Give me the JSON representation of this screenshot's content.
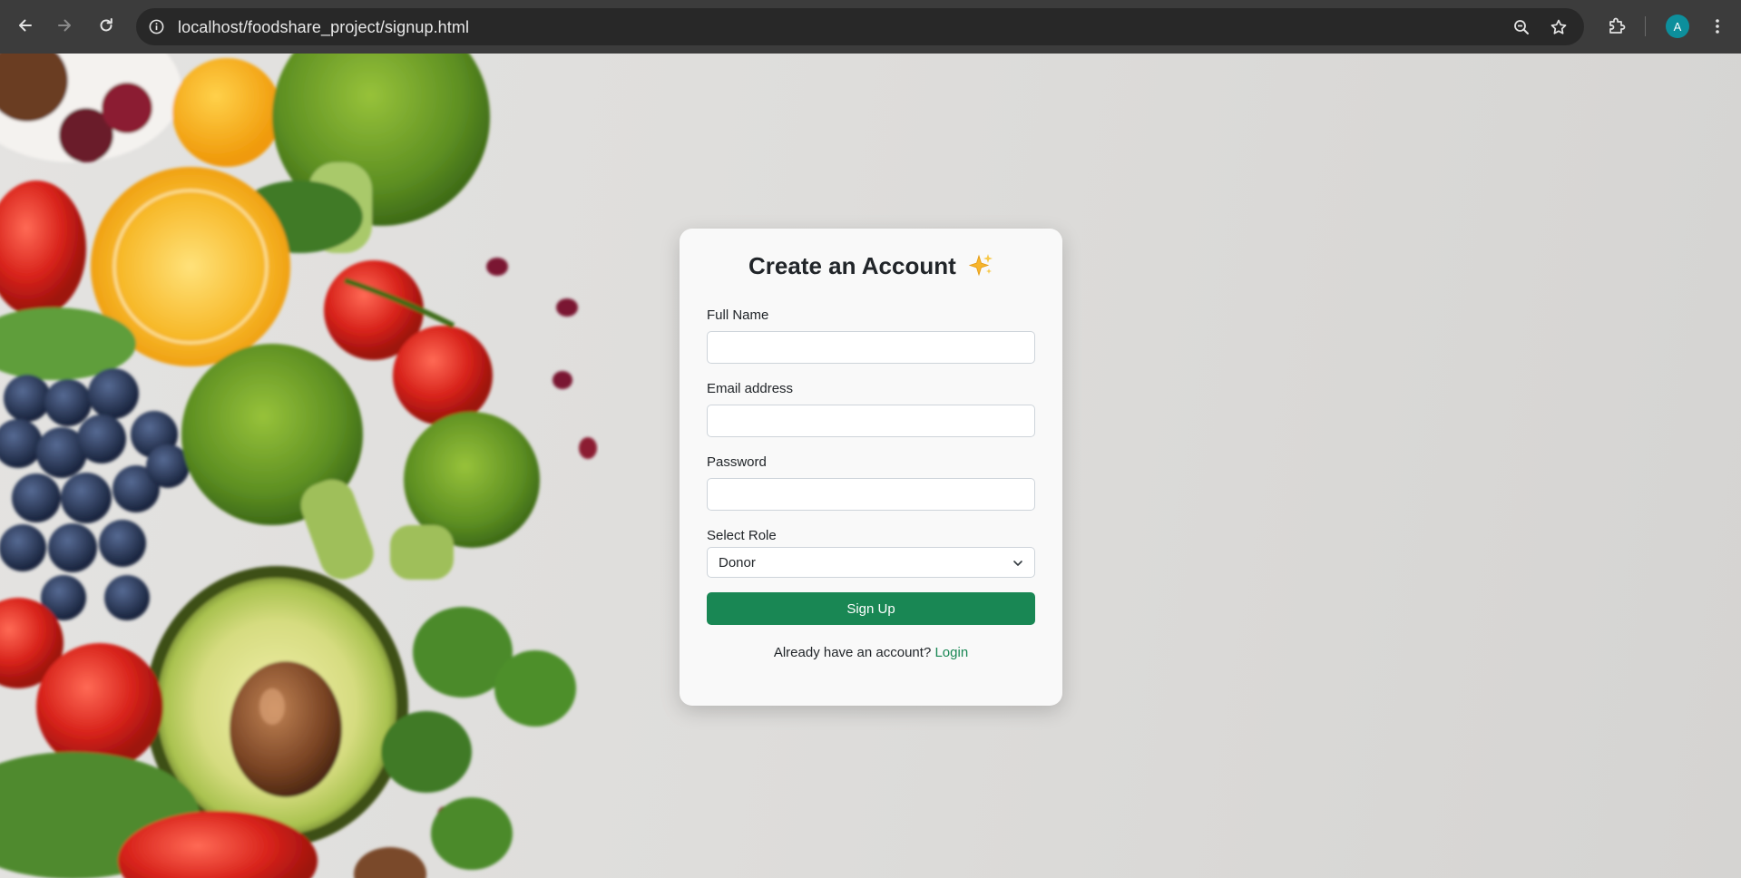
{
  "browser": {
    "url": "localhost/foodshare_project/signup.html",
    "profile_initial": "A",
    "icons": [
      "back-arrow-icon",
      "forward-arrow-icon",
      "reload-icon",
      "site-info-icon",
      "zoom-out-icon",
      "bookmark-star-icon",
      "extensions-puzzle-icon",
      "menu-kebab-icon"
    ]
  },
  "signup": {
    "title": "Create an Account",
    "title_icon": "sparkles-icon",
    "full_name_label": "Full Name",
    "full_name_value": "",
    "email_label": "Email address",
    "email_value": "",
    "password_label": "Password",
    "password_value": "",
    "role_label": "Select Role",
    "role_selected": "Donor",
    "submit_label": "Sign Up",
    "login_prompt": "Already have an account?",
    "login_link": "Login"
  },
  "colors": {
    "primary_button": "#198754",
    "link": "#198754",
    "browser_toolbar": "#3c3c3c",
    "avatar": "#0d8f9c"
  }
}
